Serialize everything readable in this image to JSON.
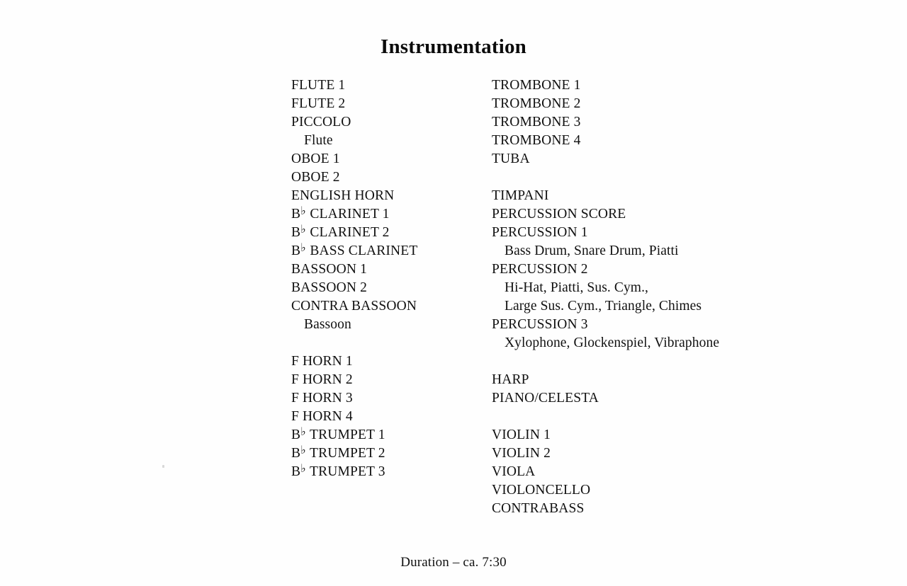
{
  "document": {
    "title": "Instrumentation",
    "footer": "Duration – ca. 7:30"
  },
  "columns": {
    "left": [
      {
        "kind": "main",
        "text": "FLUTE 1"
      },
      {
        "kind": "main",
        "text": "FLUTE 2"
      },
      {
        "kind": "main",
        "text": "PICCOLO"
      },
      {
        "kind": "sub",
        "text": "Flute"
      },
      {
        "kind": "main",
        "text": "OBOE 1"
      },
      {
        "kind": "main",
        "text": "OBOE 2"
      },
      {
        "kind": "main",
        "text": "ENGLISH HORN"
      },
      {
        "kind": "main",
        "pitch": "B",
        "accidental": "♭",
        "text": " CLARINET 1"
      },
      {
        "kind": "main",
        "pitch": "B",
        "accidental": "♭",
        "text": " CLARINET 2"
      },
      {
        "kind": "main",
        "pitch": "B",
        "accidental": "♭",
        "text": " BASS CLARINET"
      },
      {
        "kind": "main",
        "text": "BASSOON 1"
      },
      {
        "kind": "main",
        "text": "BASSOON 2"
      },
      {
        "kind": "main",
        "text": "CONTRA BASSOON"
      },
      {
        "kind": "sub",
        "text": "Bassoon"
      },
      {
        "kind": "spacer",
        "text": ""
      },
      {
        "kind": "main",
        "text": "F HORN 1"
      },
      {
        "kind": "main",
        "text": "F HORN 2"
      },
      {
        "kind": "main",
        "text": "F HORN 3"
      },
      {
        "kind": "main",
        "text": "F HORN 4"
      },
      {
        "kind": "main",
        "pitch": "B",
        "accidental": "♭",
        "text": " TRUMPET 1"
      },
      {
        "kind": "main",
        "pitch": "B",
        "accidental": "♭",
        "text": " TRUMPET 2"
      },
      {
        "kind": "main",
        "pitch": "B",
        "accidental": "♭",
        "text": " TRUMPET 3"
      }
    ],
    "right": [
      {
        "kind": "main",
        "text": "TROMBONE 1"
      },
      {
        "kind": "main",
        "text": "TROMBONE 2"
      },
      {
        "kind": "main",
        "text": "TROMBONE 3"
      },
      {
        "kind": "main",
        "text": "TROMBONE 4"
      },
      {
        "kind": "main",
        "text": "TUBA"
      },
      {
        "kind": "spacer",
        "text": ""
      },
      {
        "kind": "main",
        "text": "TIMPANI"
      },
      {
        "kind": "main",
        "text": "PERCUSSION SCORE"
      },
      {
        "kind": "main",
        "text": "PERCUSSION 1"
      },
      {
        "kind": "sub",
        "text": "Bass Drum, Snare Drum, Piatti"
      },
      {
        "kind": "main",
        "text": "PERCUSSION 2"
      },
      {
        "kind": "sub",
        "text": "Hi-Hat, Piatti, Sus. Cym.,"
      },
      {
        "kind": "sub",
        "text": "Large Sus. Cym., Triangle, Chimes"
      },
      {
        "kind": "main",
        "text": "PERCUSSION 3"
      },
      {
        "kind": "sub",
        "text": "Xylophone, Glockenspiel, Vibraphone"
      },
      {
        "kind": "spacer",
        "text": ""
      },
      {
        "kind": "main",
        "text": "HARP"
      },
      {
        "kind": "main",
        "text": "PIANO/CELESTA"
      },
      {
        "kind": "spacer",
        "text": ""
      },
      {
        "kind": "main",
        "text": "VIOLIN 1"
      },
      {
        "kind": "main",
        "text": "VIOLIN 2"
      },
      {
        "kind": "main",
        "text": "VIOLA"
      },
      {
        "kind": "main",
        "text": "VIOLONCELLO"
      },
      {
        "kind": "main",
        "text": "CONTRABASS"
      }
    ]
  }
}
